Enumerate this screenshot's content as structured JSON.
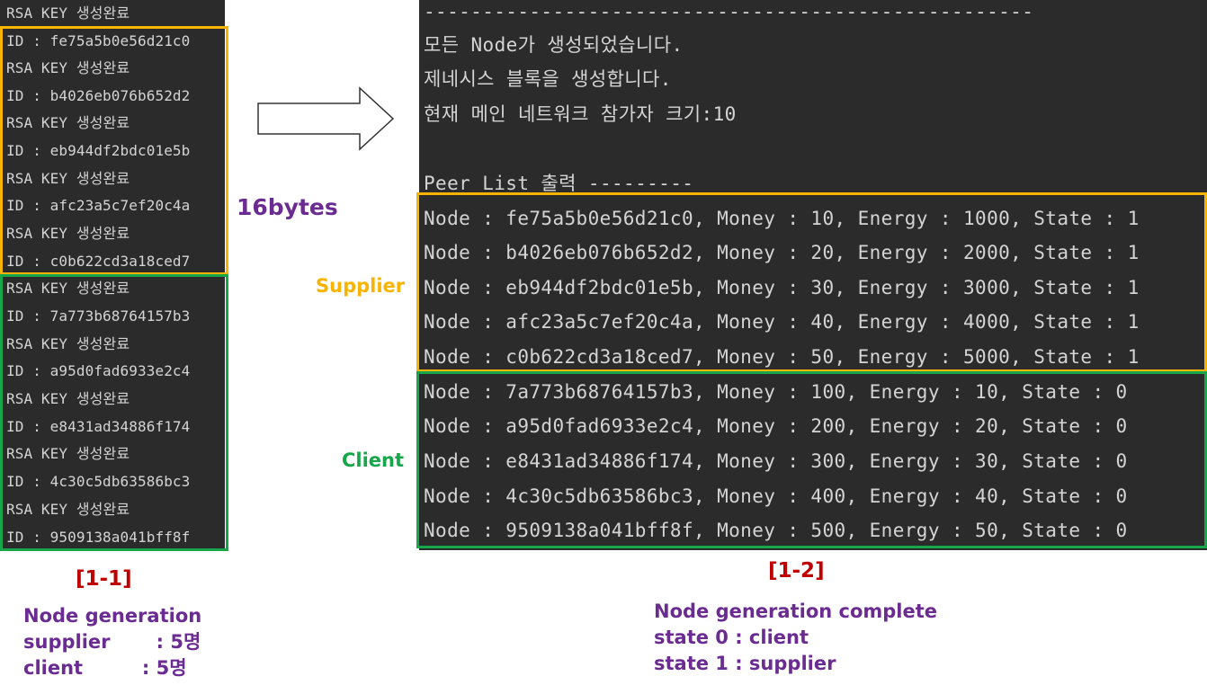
{
  "left_panel": {
    "lines": [
      "RSA KEY 생성완료",
      "ID : fe75a5b0e56d21c0",
      "RSA KEY 생성완료",
      "ID : b4026eb076b652d2",
      "RSA KEY 생성완료",
      "ID : eb944df2bdc01e5b",
      "RSA KEY 생성완료",
      "ID : afc23a5c7ef20c4a",
      "RSA KEY 생성완료",
      "ID : c0b622cd3a18ced7",
      "RSA KEY 생성완료",
      "ID : 7a773b68764157b3",
      "RSA KEY 생성완료",
      "ID : a95d0fad6933e2c4",
      "RSA KEY 생성완료",
      "ID : e8431ad34886f174",
      "RSA KEY 생성완료",
      "ID : 4c30c5db63586bc3",
      "RSA KEY 생성완료",
      "ID : 9509138a041bff8f"
    ]
  },
  "right_panel": {
    "lines": [
      "----------------------------------------------------",
      "모든 Node가 생성되었습니다.",
      "제네시스 블록을 생성합니다.",
      "현재 메인 네트워크 참가자 크기:10",
      "",
      "Peer List 출력 ---------",
      "Node : fe75a5b0e56d21c0, Money : 10, Energy : 1000, State : 1",
      "Node : b4026eb076b652d2, Money : 20, Energy : 2000, State : 1",
      "Node : eb944df2bdc01e5b, Money : 30, Energy : 3000, State : 1",
      "Node : afc23a5c7ef20c4a, Money : 40, Energy : 4000, State : 1",
      "Node : c0b622cd3a18ced7, Money : 50, Energy : 5000, State : 1",
      "Node : 7a773b68764157b3, Money : 100, Energy : 10, State : 0",
      "Node : a95d0fad6933e2c4, Money : 200, Energy : 20, State : 0",
      "Node : e8431ad34886f174, Money : 300, Energy : 30, State : 0",
      "Node : 4c30c5db63586bc3, Money : 400, Energy : 40, State : 0",
      "Node : 9509138a041bff8f, Money : 500, Energy : 50, State : 0"
    ]
  },
  "annotations": {
    "bytes_label": "16bytes",
    "supplier_label": "Supplier",
    "client_label": "Client",
    "ref_left": "[1-1]",
    "ref_right": "[1-2]",
    "caption_left": {
      "line1": "Node generation",
      "line2": "supplier       : 5명",
      "line3": "client         : 5명"
    },
    "caption_right": {
      "line1": "Node generation complete",
      "line2": "state 0 : client",
      "line3": "state 1 : supplier"
    }
  },
  "colors": {
    "terminal_bg": "#2b2b2b",
    "terminal_text": "#d4d4d4",
    "supplier_yellow": "#f8b400",
    "client_green": "#17a64a",
    "ref_red": "#c00000",
    "caption_purple": "#6a2c91"
  }
}
